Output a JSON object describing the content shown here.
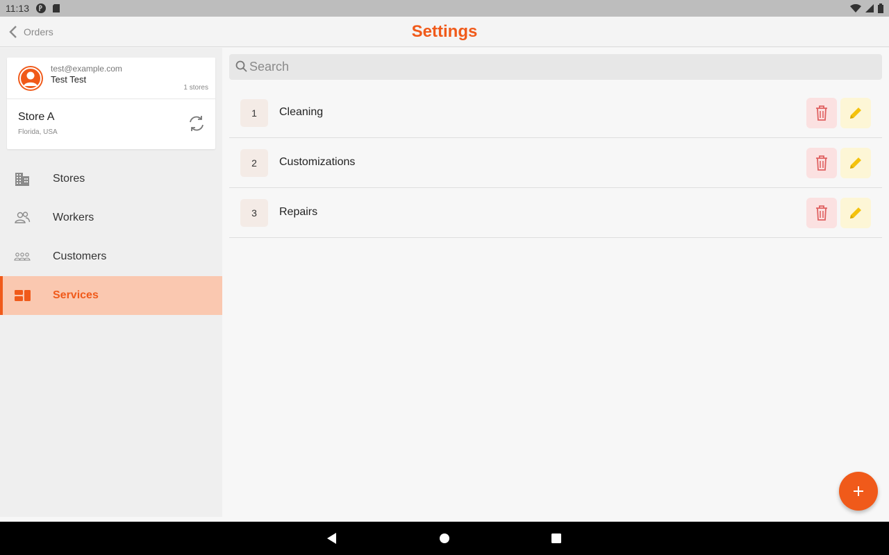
{
  "statusbar": {
    "time": "11:13"
  },
  "appbar": {
    "back_label": "Orders",
    "title": "Settings"
  },
  "account": {
    "email": "test@example.com",
    "name": "Test Test",
    "stores_count": "1 stores",
    "store_name": "Store A",
    "store_location": "Florida, USA"
  },
  "nav": {
    "items": [
      {
        "label": "Stores",
        "icon": "building-icon"
      },
      {
        "label": "Workers",
        "icon": "workers-icon"
      },
      {
        "label": "Customers",
        "icon": "customers-icon"
      },
      {
        "label": "Services",
        "icon": "services-icon",
        "active": true
      }
    ]
  },
  "search": {
    "placeholder": "Search",
    "value": ""
  },
  "services": [
    {
      "index": "1",
      "name": "Cleaning"
    },
    {
      "index": "2",
      "name": "Customizations"
    },
    {
      "index": "3",
      "name": "Repairs"
    }
  ],
  "colors": {
    "accent": "#f05a1a",
    "active_bg": "#fac8b0",
    "delete_bg": "#fbe1e1",
    "delete_icon": "#e06060",
    "edit_bg": "#fdf6d6",
    "edit_icon": "#f4c20d"
  }
}
